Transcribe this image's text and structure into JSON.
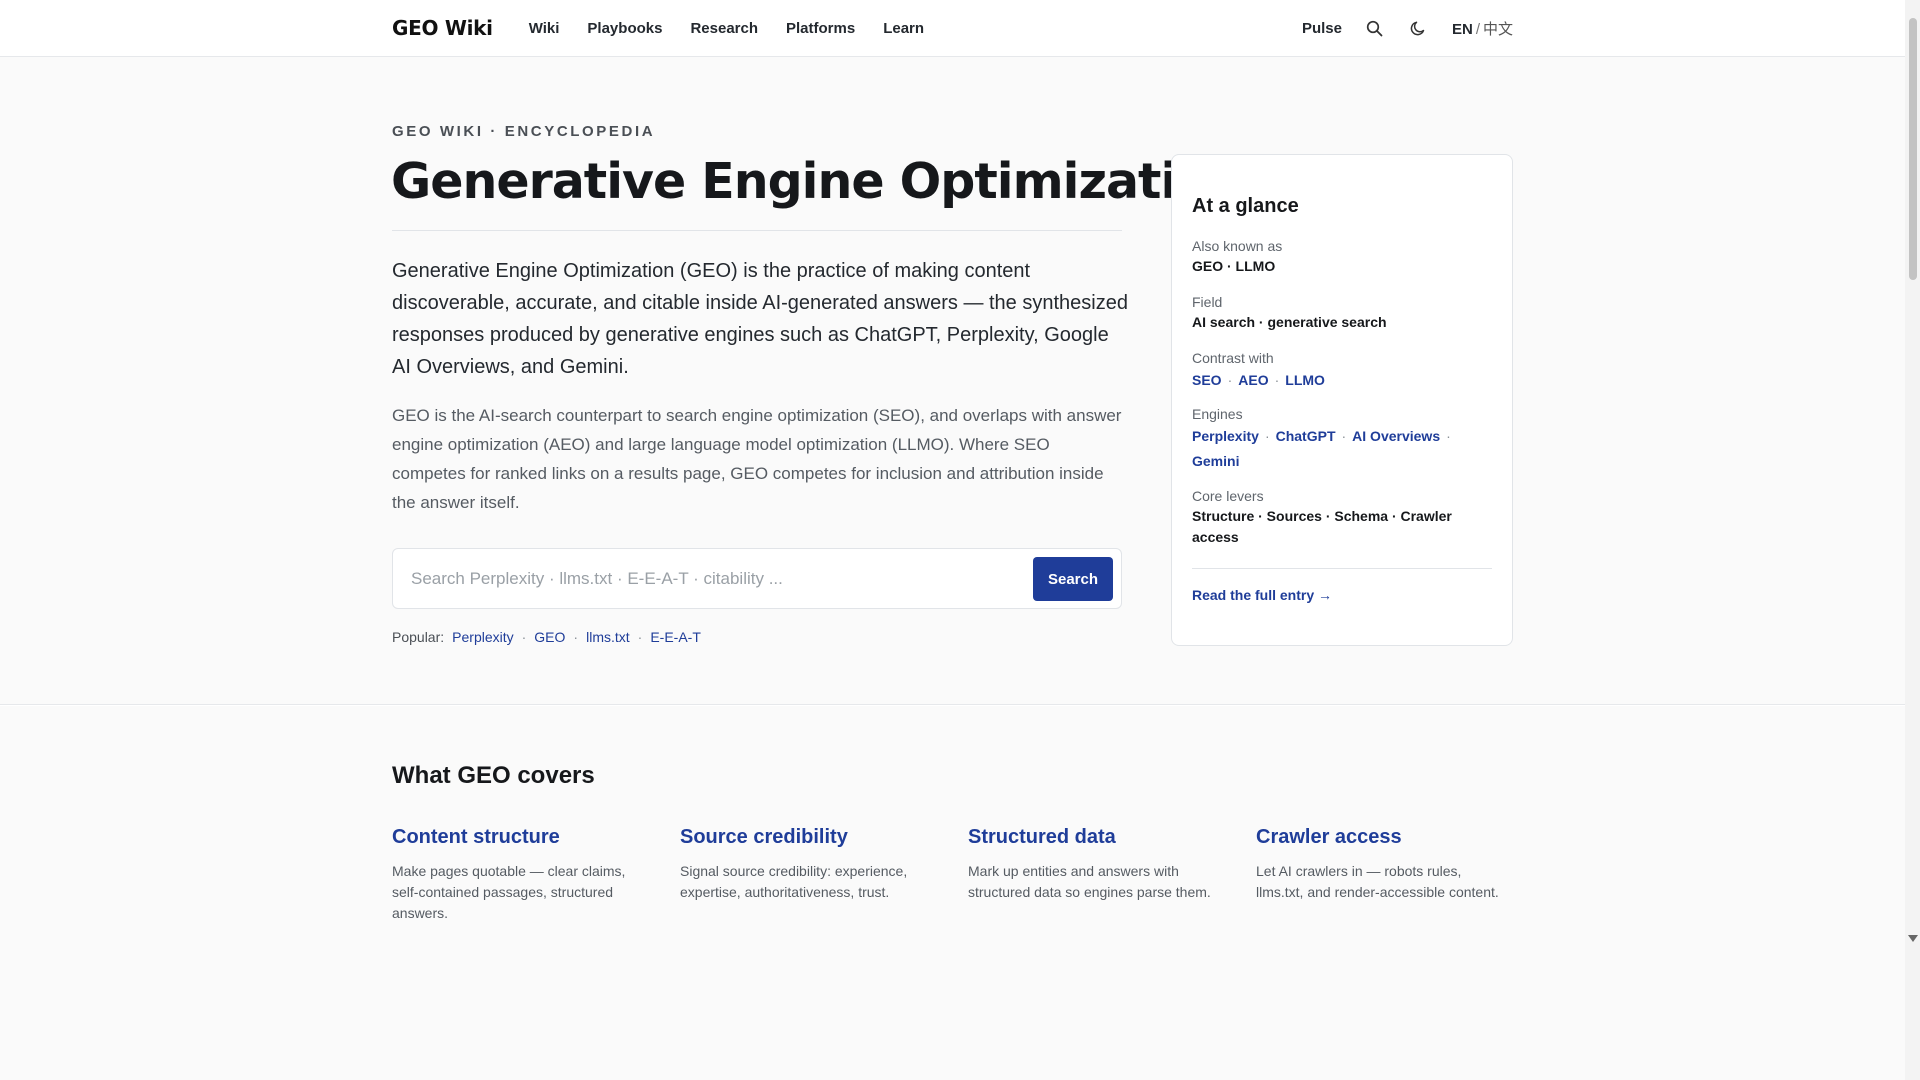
{
  "header": {
    "brand": "GEO Wiki",
    "nav": [
      "Wiki",
      "Playbooks",
      "Research",
      "Platforms",
      "Learn"
    ],
    "pulse": "Pulse",
    "lang_en": "EN",
    "lang_sep": "/",
    "lang_zh": "中文"
  },
  "hero": {
    "eyebrow": "GEO WIKI · ENCYCLOPEDIA",
    "title": "Generative Engine Optimization",
    "lede": "Generative Engine Optimization (GEO) is the practice of making content discoverable, accurate, and citable inside AI-generated answers — the synthesized responses produced by generative engines such as ChatGPT, Perplexity, Google AI Overviews, and Gemini.",
    "body": "GEO is the AI-search counterpart to search engine optimization (SEO), and overlaps with answer engine optimization (AEO) and large language model optimization (LLMO). Where SEO competes for ranked links on a results page, GEO competes for inclusion and attribution inside the answer itself.",
    "search_placeholder": "Search Perplexity · llms.txt · E-E-A-T · citability ...",
    "search_button": "Search",
    "popular_label": "Popular:",
    "popular_links": [
      "Perplexity",
      "GEO",
      "llms.txt",
      "E-E-A-T"
    ]
  },
  "glance": {
    "title": "At a glance",
    "aka_label": "Also known as",
    "aka_value": "GEO · LLMO",
    "field_label": "Field",
    "field_value": "AI search · generative search",
    "contrast_label": "Contrast with",
    "contrast_links": [
      "SEO",
      "AEO",
      "LLMO"
    ],
    "engines_label": "Engines",
    "engines_links": [
      "Perplexity",
      "ChatGPT",
      "AI Overviews",
      "Gemini"
    ],
    "levers_label": "Core levers",
    "levers_value": "Structure · Sources · Schema · Crawler access",
    "read_more": "Read the full entry →"
  },
  "covers": {
    "title": "What GEO covers",
    "items": [
      {
        "title": "Content structure",
        "desc": "Make pages quotable — clear claims, self-contained passages, structured answers."
      },
      {
        "title": "Source credibility",
        "desc": "Signal source credibility: experience, expertise, authoritativeness, trust."
      },
      {
        "title": "Structured data",
        "desc": "Mark up entities and answers with structured data so engines parse them."
      },
      {
        "title": "Crawler access",
        "desc": "Let AI crawlers in — robots rules, llms.txt, and render-accessible content."
      }
    ]
  }
}
